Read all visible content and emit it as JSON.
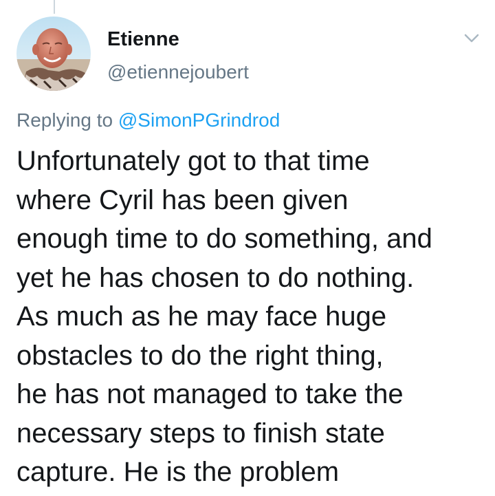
{
  "tweet": {
    "author_name": "Etienne",
    "author_handle": "@etiennejoubert",
    "replying_prefix": "Replying to ",
    "replying_to": "@SimonPGrindrod",
    "text_lines": [
      "Unfortunately got to that time",
      "where Cyril has been given",
      "enough time to do something, and",
      "yet he has chosen to do nothing.",
      "As much as he may face huge",
      "obstacles to do the right thing,",
      "he has not managed to take the",
      "necessary steps to finish state",
      "capture. He is the problem"
    ]
  },
  "icons": {
    "menu": "chevron-down-icon",
    "avatar": "profile-photo"
  },
  "colors": {
    "text": "#14171a",
    "secondary": "#657786",
    "link": "#1da1f2",
    "thread_line": "#ccd6dd"
  }
}
